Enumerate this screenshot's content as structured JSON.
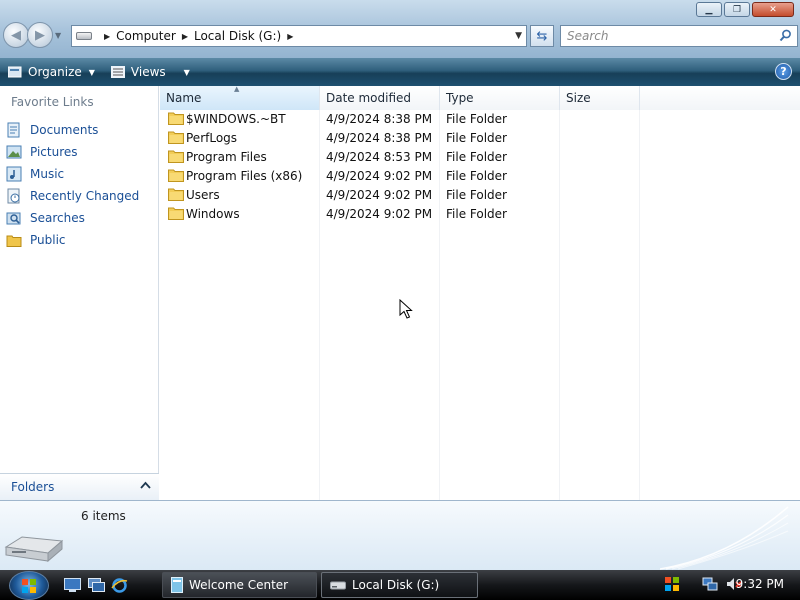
{
  "window": {
    "controls": {
      "minimize_icon": "minimize-icon",
      "maximize_icon": "maximize-icon",
      "close_icon": "close-icon"
    }
  },
  "address_bar": {
    "breadcrumbs": [
      "Computer",
      "Local Disk (G:)"
    ],
    "search_placeholder": "Search"
  },
  "command_bar": {
    "organize_label": "Organize",
    "views_label": "Views"
  },
  "nav_pane": {
    "title": "Favorite Links",
    "items": [
      {
        "label": "Documents",
        "icon": "documents-icon"
      },
      {
        "label": "Pictures",
        "icon": "pictures-icon"
      },
      {
        "label": "Music",
        "icon": "music-icon"
      },
      {
        "label": "Recently Changed",
        "icon": "recently-changed-icon"
      },
      {
        "label": "Searches",
        "icon": "searches-icon"
      },
      {
        "label": "Public",
        "icon": "public-folder-icon"
      }
    ],
    "folders_label": "Folders"
  },
  "file_list": {
    "columns": [
      "Name",
      "Date modified",
      "Type",
      "Size"
    ],
    "rows": [
      {
        "name": "$WINDOWS.~BT",
        "date": "4/9/2024 8:38 PM",
        "type": "File Folder",
        "size": ""
      },
      {
        "name": "PerfLogs",
        "date": "4/9/2024 8:38 PM",
        "type": "File Folder",
        "size": ""
      },
      {
        "name": "Program Files",
        "date": "4/9/2024 8:53 PM",
        "type": "File Folder",
        "size": ""
      },
      {
        "name": "Program Files (x86)",
        "date": "4/9/2024 9:02 PM",
        "type": "File Folder",
        "size": ""
      },
      {
        "name": "Users",
        "date": "4/9/2024 9:02 PM",
        "type": "File Folder",
        "size": ""
      },
      {
        "name": "Windows",
        "date": "4/9/2024 9:02 PM",
        "type": "File Folder",
        "size": ""
      }
    ]
  },
  "details_pane": {
    "item_count": "6 items"
  },
  "taskbar": {
    "buttons": [
      "Welcome Center",
      "Local Disk (G:)"
    ],
    "clock": "9:32 PM"
  }
}
